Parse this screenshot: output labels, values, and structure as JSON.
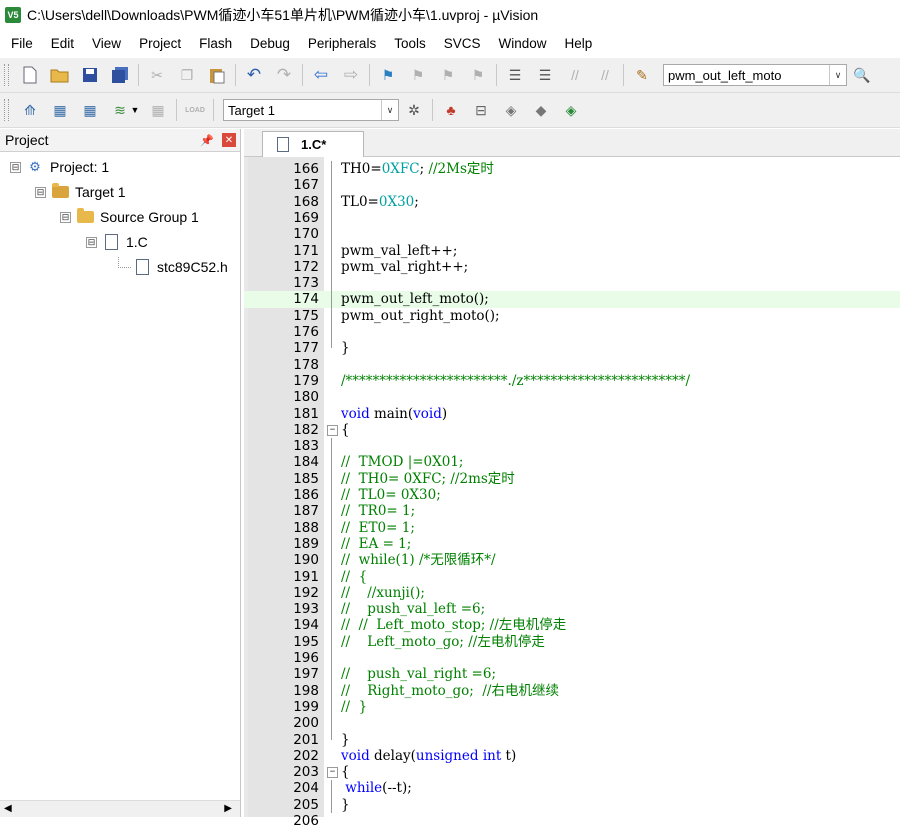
{
  "window": {
    "title": "C:\\Users\\dell\\Downloads\\PWM循迹小车51单片机\\PWM循迹小车\\1.uvproj - µVision",
    "app_icon": "V5"
  },
  "menu": [
    "File",
    "Edit",
    "View",
    "Project",
    "Flash",
    "Debug",
    "Peripherals",
    "Tools",
    "SVCS",
    "Window",
    "Help"
  ],
  "toolbar": {
    "find_combo_value": "pwm_out_left_moto",
    "target_combo_value": "Target 1",
    "load_label": "LOAD"
  },
  "project_panel": {
    "title": "Project",
    "tree": [
      {
        "label": "Project: 1",
        "icon": "project-icon",
        "expander": "⊟"
      },
      {
        "label": "Target 1",
        "icon": "target-icon",
        "expander": "⊟"
      },
      {
        "label": "Source Group 1",
        "icon": "folder-icon",
        "expander": "⊟"
      },
      {
        "label": "1.C",
        "icon": "file-icon",
        "expander": "⊟"
      },
      {
        "label": "stc89C52.h",
        "icon": "header-file-icon",
        "expander": ""
      }
    ]
  },
  "editor": {
    "tab_label": "1.C*",
    "highlighted_line": 174,
    "lines": [
      {
        "n": "166",
        "text": "TH0=0XFC; //2Ms定时"
      },
      {
        "n": "167",
        "text": ""
      },
      {
        "n": "168",
        "text": "TL0=0X30;"
      },
      {
        "n": "169",
        "text": ""
      },
      {
        "n": "170",
        "text": ""
      },
      {
        "n": "171",
        "text": "pwm_val_left++;"
      },
      {
        "n": "172",
        "text": "pwm_val_right++;"
      },
      {
        "n": "173",
        "text": ""
      },
      {
        "n": "174",
        "text": "pwm_out_left_moto();"
      },
      {
        "n": "175",
        "text": "pwm_out_right_moto();"
      },
      {
        "n": "176",
        "text": ""
      },
      {
        "n": "177",
        "text": "}"
      },
      {
        "n": "178",
        "text": ""
      },
      {
        "n": "179",
        "text": "/************************./z************************/"
      },
      {
        "n": "180",
        "text": ""
      },
      {
        "n": "181",
        "text": "void main(void)"
      },
      {
        "n": "182",
        "text": "{"
      },
      {
        "n": "183",
        "text": ""
      },
      {
        "n": "184",
        "text": "//  TMOD |=0X01;"
      },
      {
        "n": "185",
        "text": "//  TH0= 0XFC; //2ms定时"
      },
      {
        "n": "186",
        "text": "//  TL0= 0X30;"
      },
      {
        "n": "187",
        "text": "//  TR0= 1;"
      },
      {
        "n": "188",
        "text": "//  ET0= 1;"
      },
      {
        "n": "189",
        "text": "//  EA = 1;"
      },
      {
        "n": "190",
        "text": "//  while(1) /*无限循环*/"
      },
      {
        "n": "191",
        "text": "//  {"
      },
      {
        "n": "192",
        "text": "//    //xunji();"
      },
      {
        "n": "193",
        "text": "//    push_val_left =6;"
      },
      {
        "n": "194",
        "text": "//  //  Left_moto_stop; //左电机停走"
      },
      {
        "n": "195",
        "text": "//    Left_moto_go; //左电机停走"
      },
      {
        "n": "196",
        "text": ""
      },
      {
        "n": "197",
        "text": "//    push_val_right =6;"
      },
      {
        "n": "198",
        "text": "//    Right_moto_go;  //右电机继续"
      },
      {
        "n": "199",
        "text": "//  }"
      },
      {
        "n": "200",
        "text": ""
      },
      {
        "n": "201",
        "text": "}"
      },
      {
        "n": "202",
        "text": "void delay(unsigned int t)"
      },
      {
        "n": "203",
        "text": "{"
      },
      {
        "n": "204",
        "text": " while(--t);"
      },
      {
        "n": "205",
        "text": "}"
      },
      {
        "n": "206",
        "text": ""
      }
    ]
  },
  "colors": {
    "keyword": "#0000ff",
    "number": "#00a0a0",
    "comment": "#008000",
    "line_highlight": "#e8fce8"
  }
}
